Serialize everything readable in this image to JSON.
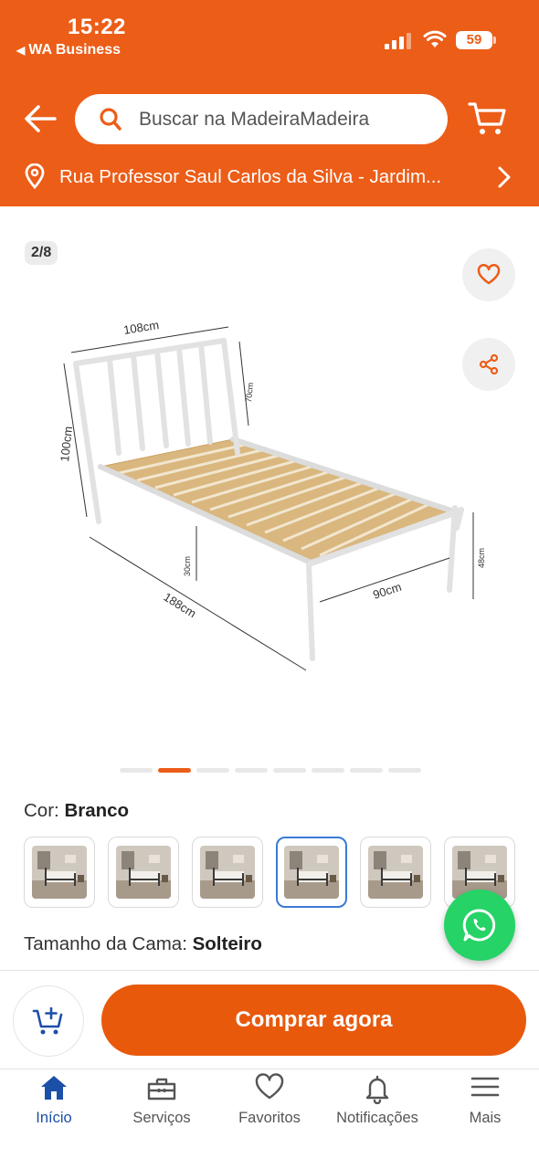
{
  "status_bar": {
    "time": "15:22",
    "back_app": "WA Business",
    "battery": "59"
  },
  "header": {
    "search_placeholder": "Buscar na MadeiraMadeira",
    "address": "Rua Professor Saul Carlos da Silva - Jardim..."
  },
  "gallery": {
    "counter": "2/8",
    "total_images": 8,
    "active_index": 1,
    "dimensions": {
      "width_top": "108",
      "height_head": "100",
      "height_inner": "70",
      "length": "188",
      "leg": "30",
      "width_foot": "90",
      "height_foot": "48",
      "unit": "cm"
    }
  },
  "color": {
    "label": "Cor: ",
    "value": "Branco",
    "selected_index": 3,
    "thumbnails": [
      "variant-1",
      "variant-2",
      "variant-3",
      "variant-4",
      "variant-5",
      "variant-6"
    ]
  },
  "size": {
    "label": "Tamanho da Cama: ",
    "value": "Solteiro"
  },
  "buy": {
    "label": "Comprar agora"
  },
  "bottom_nav": [
    {
      "label": "Início",
      "icon": "home-icon",
      "active": true
    },
    {
      "label": "Serviços",
      "icon": "toolbox-icon",
      "active": false
    },
    {
      "label": "Favoritos",
      "icon": "heart-icon",
      "active": false
    },
    {
      "label": "Notificações",
      "icon": "bell-icon",
      "active": false
    },
    {
      "label": "Mais",
      "icon": "menu-icon",
      "active": false
    }
  ],
  "colors": {
    "brand": "#ec5d18",
    "buy_button": "#e8590c",
    "whatsapp": "#25d366",
    "nav_active": "#1c4fa8",
    "selected_border": "#3a7bd5"
  }
}
